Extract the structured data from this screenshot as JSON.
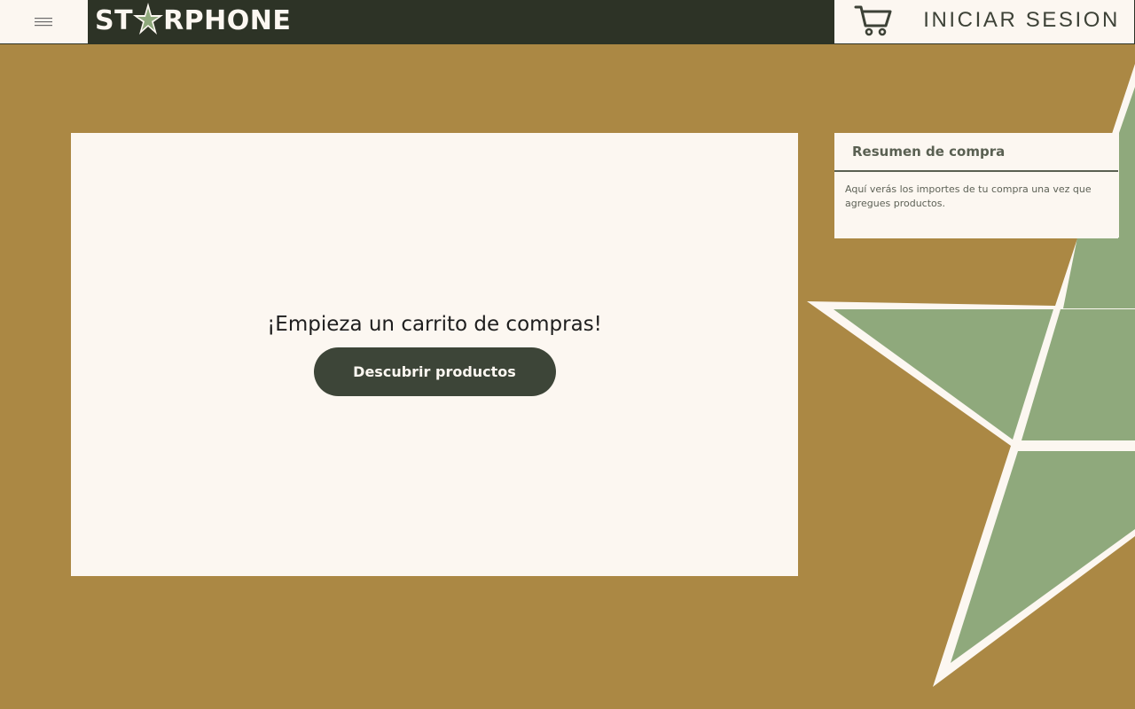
{
  "header": {
    "menu_icon": "hamburger-icon",
    "logo_text_left": "ST",
    "logo_text_right": "RPHONE",
    "logo_alt": "STARPHONE",
    "cart_icon": "shopping-cart-icon",
    "login_label": "INICIAR SESION"
  },
  "cart": {
    "empty_message": "¡Empieza un carrito de compras!",
    "discover_label": "Descubrir productos"
  },
  "summary": {
    "title": "Resumen de compra",
    "description": "Aquí verás los importes de tu compra una vez que agregues productos."
  },
  "colors": {
    "background": "#ab8844",
    "dark_green": "#2d3326",
    "cream": "#fcf7f1",
    "star_green": "#8fa97c",
    "button": "#3d4538"
  }
}
